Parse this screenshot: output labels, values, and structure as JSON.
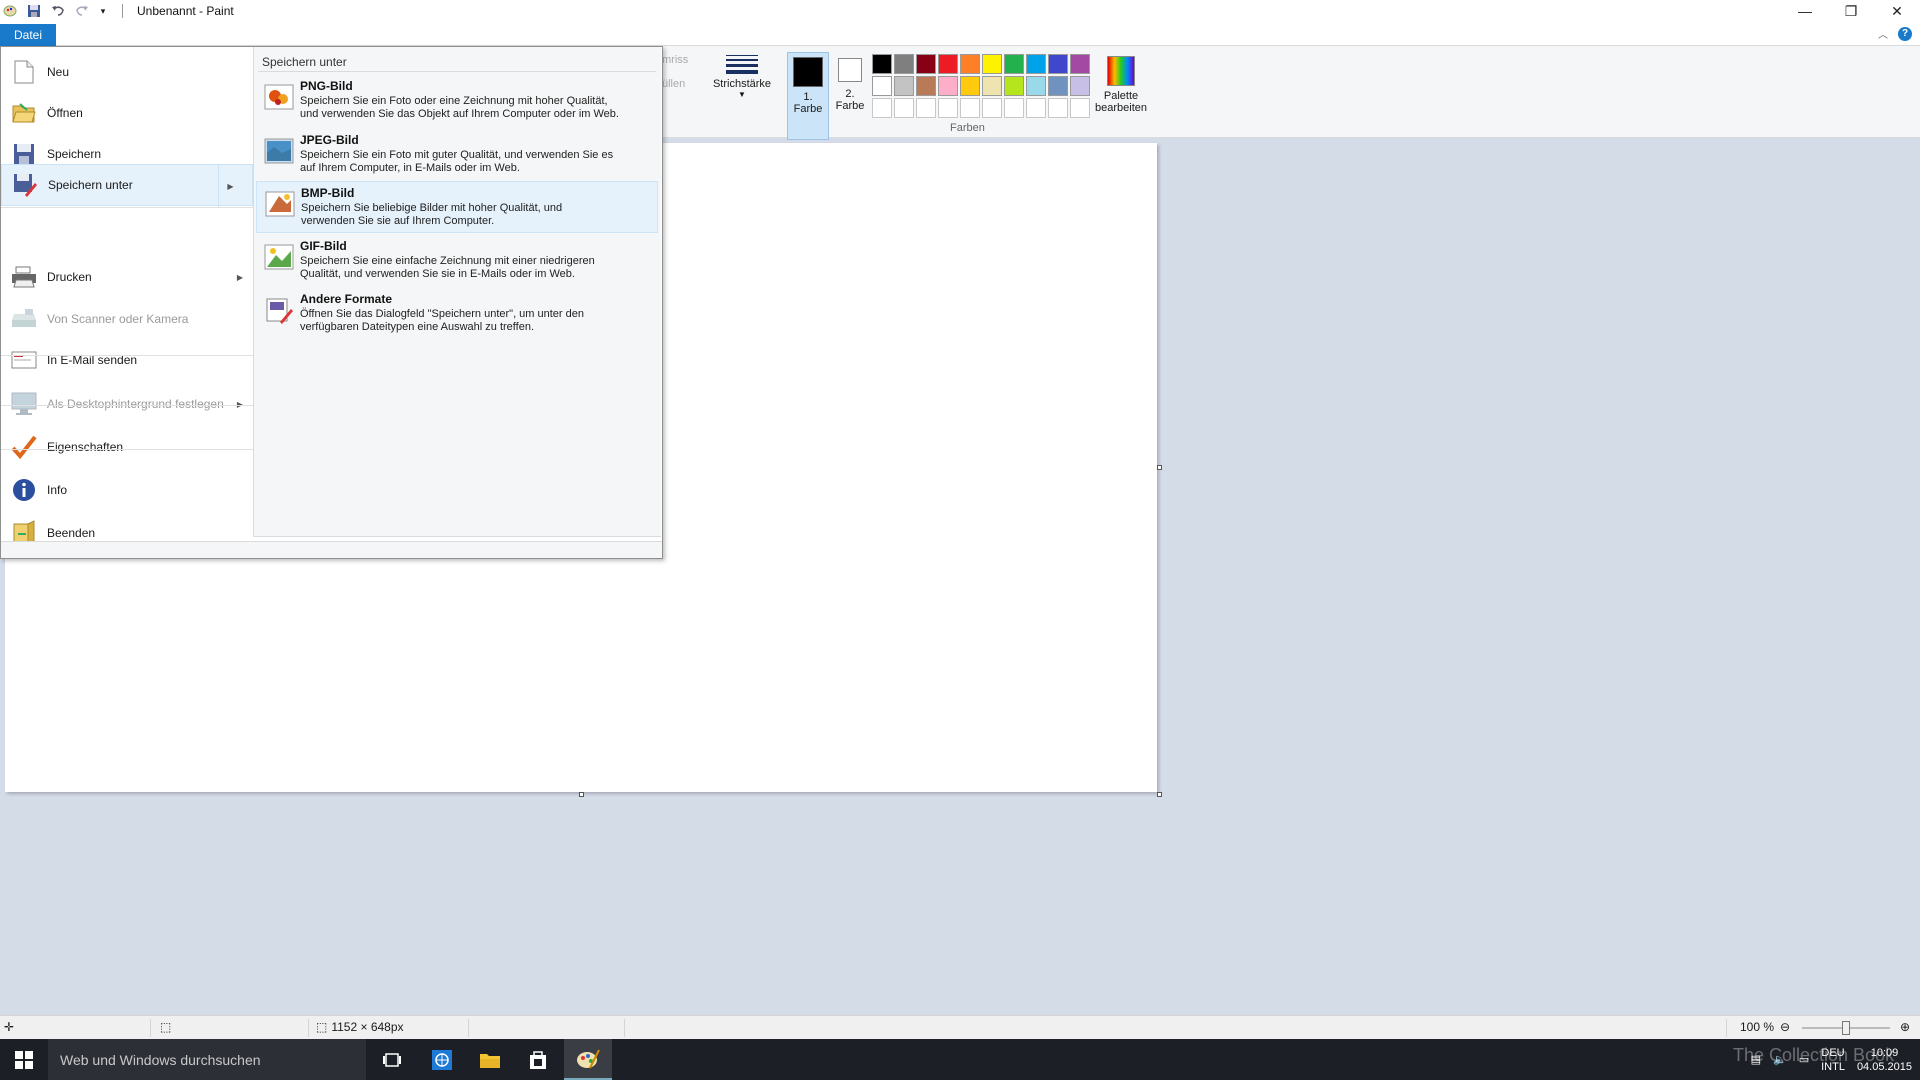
{
  "window": {
    "title": "Unbenannt - Paint"
  },
  "ribbon": {
    "file_tab": "Datei",
    "dim_text_1": "mriss",
    "dim_text_2": "üllen",
    "stroke_label": "Strichstärke",
    "color1_label_1": "1.",
    "color1_label_2": "Farbe",
    "color2_label_1": "2.",
    "color2_label_2": "Farbe",
    "palette_edit_1": "Palette",
    "palette_edit_2": "bearbeiten",
    "colors_group": "Farben",
    "palette_colors": [
      "#000000",
      "#7f7f7f",
      "#880015",
      "#ed1c24",
      "#ff7f27",
      "#fff200",
      "#22b14c",
      "#00a2e8",
      "#3f48cc",
      "#a349a4",
      "#ffffff",
      "#c3c3c3",
      "#b97a57",
      "#ffaec9",
      "#ffc90e",
      "#efe4b0",
      "#b5e61d",
      "#99d9ea",
      "#7092be",
      "#c8bfe7",
      "#ffffff",
      "#ffffff",
      "#ffffff",
      "#ffffff",
      "#ffffff",
      "#ffffff",
      "#ffffff",
      "#ffffff",
      "#ffffff",
      "#ffffff"
    ]
  },
  "menu": {
    "items": [
      {
        "label": "Neu"
      },
      {
        "label": "Öffnen"
      },
      {
        "label": "Speichern"
      },
      {
        "label": "Speichern unter"
      },
      {
        "label": "Drucken"
      },
      {
        "label": "Von Scanner oder Kamera"
      },
      {
        "label": "In E-Mail senden"
      },
      {
        "label": "Als Desktophintergrund festlegen"
      },
      {
        "label": "Eigenschaften"
      },
      {
        "label": "Info"
      },
      {
        "label": "Beenden"
      }
    ],
    "submenu": {
      "title": "Speichern unter",
      "items": [
        {
          "title": "PNG-Bild",
          "desc1": "Speichern Sie ein Foto oder eine Zeichnung mit hoher Qualität,",
          "desc2": "und verwenden Sie das Objekt auf Ihrem Computer oder im Web."
        },
        {
          "title": "JPEG-Bild",
          "desc1": "Speichern Sie ein Foto mit guter Qualität, und verwenden Sie es",
          "desc2": "auf Ihrem Computer, in E-Mails oder im Web."
        },
        {
          "title": "BMP-Bild",
          "desc1": "Speichern Sie beliebige Bilder mit hoher Qualität, und",
          "desc2": "verwenden Sie sie auf Ihrem Computer."
        },
        {
          "title": "GIF-Bild",
          "desc1": "Speichern Sie eine einfache Zeichnung mit einer niedrigeren",
          "desc2": "Qualität, und verwenden Sie sie in E-Mails oder im Web."
        },
        {
          "title": "Andere Formate",
          "desc1": "Öffnen Sie das Dialogfeld \"Speichern unter\", um unter den",
          "desc2": "verfügbaren Dateitypen eine Auswahl zu treffen."
        }
      ]
    }
  },
  "statusbar": {
    "canvas_size": "1152 × 648px",
    "zoom": "100 %"
  },
  "taskbar": {
    "search_placeholder": "Web und Windows durchsuchen",
    "watermark": "The Collection Book",
    "lang_1": "DEU",
    "lang_2": "INTL",
    "time": "10:09",
    "date": "04.05.2015"
  }
}
